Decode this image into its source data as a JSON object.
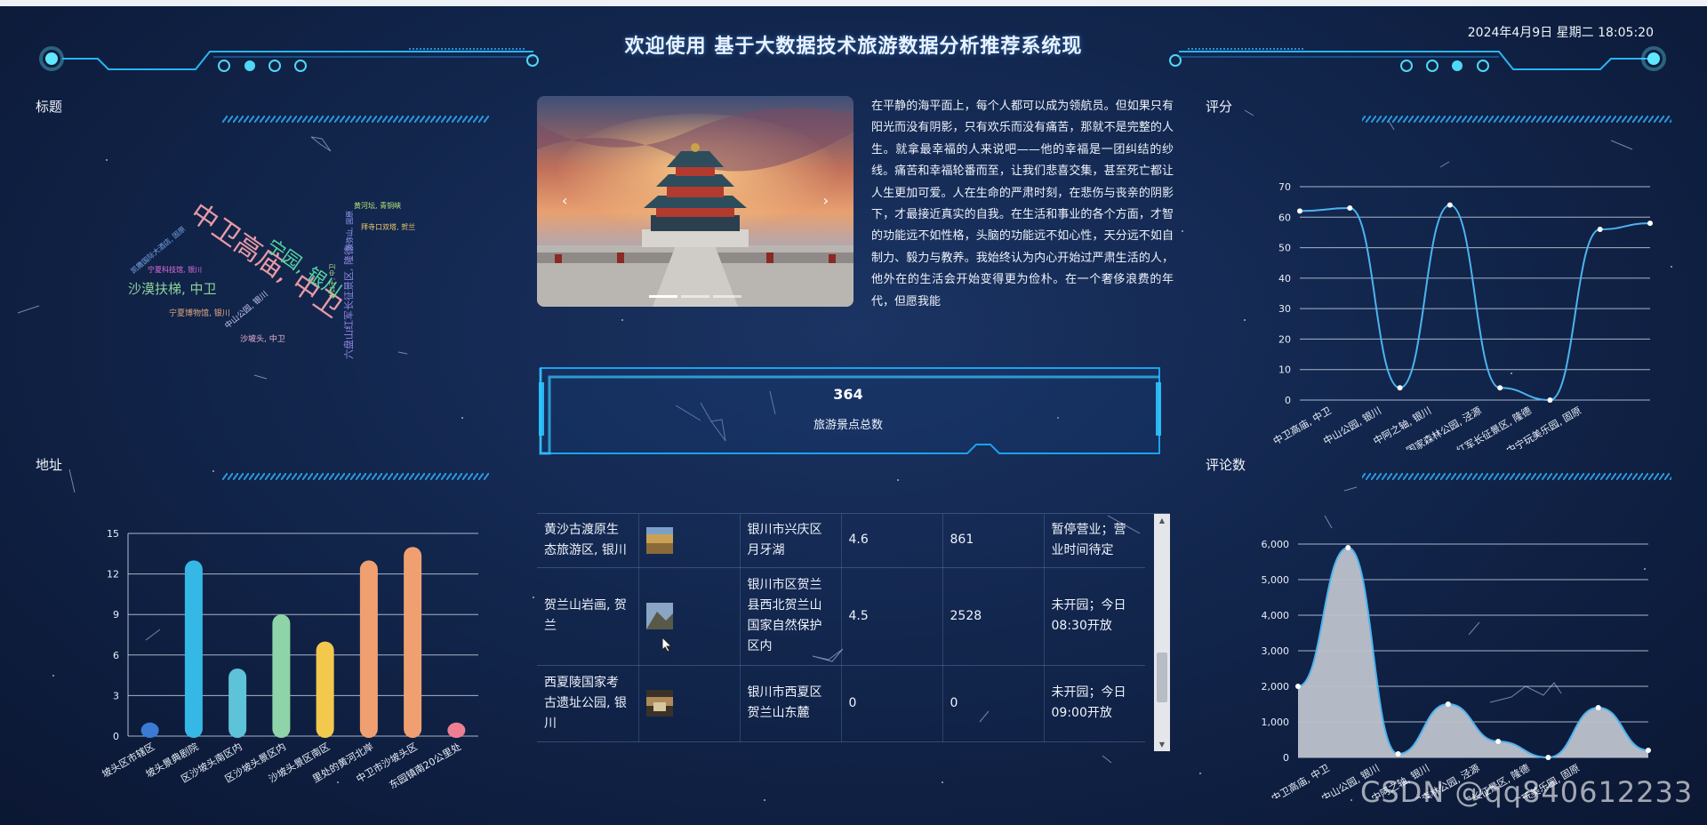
{
  "header": {
    "title": "欢迎使用 基于大数据技术旅游数据分析推荐系统现",
    "datetime": "2024年4月9日 星期二 18:05:20"
  },
  "panels": {
    "wordcloud_title": "标题",
    "address_title": "地址",
    "score_title": "评分",
    "comments_title": "评论数"
  },
  "wordcloud": [
    {
      "text": "中卫高庙, 中卫",
      "color": "#e89aa6"
    },
    {
      "text": "宁园, 银川",
      "color": "#55d6a0"
    },
    {
      "text": "沙漠扶梯, 中卫",
      "color": "#8fd19a"
    },
    {
      "text": "六盘山红军长征景区, 隆德",
      "color": "#8e86e0"
    },
    {
      "text": "宁夏博物馆, 银川",
      "color": "#e0a880"
    },
    {
      "text": "中山公园, 银川",
      "color": "#c9c9ee"
    },
    {
      "text": "沙坡头, 中卫",
      "color": "#f0b7d2"
    },
    {
      "text": "宁夏科技馆, 银川",
      "color": "#e06fe0"
    },
    {
      "text": "凯撒国际大酒店, 固原",
      "color": "#79a8e8"
    },
    {
      "text": "黄河坛, 青铜峡",
      "color": "#b8e47a"
    },
    {
      "text": "拜寺口双塔, 贺兰",
      "color": "#f0c86a"
    },
    {
      "text": "寺口子, 中卫",
      "color": "#b8e47a"
    },
    {
      "text": "须弥山, 固原",
      "color": "#9aa7ff"
    }
  ],
  "carousel": {
    "prev_icon": "chevron-left-icon",
    "next_icon": "chevron-right-icon",
    "slide_count": 3,
    "active_index": 0
  },
  "intro": {
    "text": "在平静的海平面上，每个人都可以成为领航员。但如果只有阳光而没有阴影，只有欢乐而没有痛苦，那就不是完整的人生。就拿最幸福的人来说吧——他的幸福是一团纠结的纱线。痛苦和幸福轮番而至，让我们悲喜交集，甚至死亡都让人生更加可爱。人在生命的严肃时刻，在悲伤与丧亲的阴影下，才最接近真实的自我。在生活和事业的各个方面，才智的功能远不如性格，头脑的功能远不如心性，天分远不如自制力、毅力与教养。我始终认为内心开始过严肃生活的人，他外在的生活会开始变得更为俭朴。在一个奢侈浪费的年代，但愿我能"
  },
  "stat": {
    "value": "364",
    "label": "旅游景点总数"
  },
  "table": {
    "rows": [
      {
        "name": "黄沙古渡原生态旅游区, 银川",
        "thumb_color": "#c9a055",
        "address": "银川市兴庆区月牙湖",
        "score": "4.6",
        "comments": "861",
        "status": "暂停营业；营业时间待定"
      },
      {
        "name": "贺兰山岩画, 贺兰",
        "thumb_color": "#7f8aa0",
        "address": "银川市区贺兰县西北贺兰山国家自然保护区内",
        "score": "4.5",
        "comments": "2528",
        "status": "未开园；今日08:30开放"
      },
      {
        "name": "西夏陵国家考古遗址公园, 银川",
        "thumb_color": "#6b5a44",
        "address": "银川市西夏区贺兰山东麓",
        "score": "0",
        "comments": "0",
        "status": "未开园；今日09:00开放"
      }
    ]
  },
  "watermark": "CSDN @qq840612233",
  "colors": {
    "accent": "#19a7ff",
    "line": "#4db3ef",
    "area": "#bdc2cc"
  },
  "chart_data": [
    {
      "id": "address",
      "type": "bar",
      "categories": [
        "中卫市沙坡头区市辖区",
        "沙坡头区沙坡头景典剧院",
        "沙坡头区沙坡头南区内",
        "沙坡头区沙坡头景区内",
        "沙坡头区沙坡头景区南区",
        "沙坡头区10公里处的黄河北岸",
        "中卫市沙坡头区",
        "沙坡头区东园镇南20公里处"
      ],
      "x_tick_labels": [
        "坡头区市辖区",
        "坡头景典剧院",
        "区沙坡头南区内",
        "区沙坡头景区内",
        "沙坡头景区南区",
        "里处的黄河北岸",
        "中卫市沙坡头区",
        "东园镇南20公里处"
      ],
      "values": [
        1,
        13,
        5,
        9,
        7,
        13,
        14,
        1
      ],
      "colors": [
        "#3a7bd5",
        "#35b8e6",
        "#5ec2d8",
        "#8fd4a8",
        "#f2c94c",
        "#f0a070",
        "#f0a070",
        "#ee7f93"
      ],
      "ylim": [
        0,
        15
      ],
      "yticks": [
        0,
        3,
        6,
        9,
        12,
        15
      ]
    },
    {
      "id": "score",
      "type": "line",
      "categories": [
        "中卫高庙, 中卫",
        "中山公园, 银川",
        "中阿之轴, 银川",
        "国家森林公园, 泾源",
        "六盘山红军长征景区, 隆德",
        "中宁玩美乐园, 固原"
      ],
      "x_tick_labels": [
        "中卫高庙, 中卫",
        "中山公园, 银川",
        "中阿之轴, 银川",
        "国家森林公园, 泾源",
        "红军长征景区, 隆德",
        "中宁玩美乐园, 固原"
      ],
      "x_tick_positions": [
        0.5,
        1.5,
        2.5,
        3.5,
        4.5,
        5.5
      ],
      "x": [
        0,
        1,
        2,
        3,
        4,
        5,
        6,
        7
      ],
      "values": [
        62,
        63,
        4,
        64,
        4,
        0,
        56,
        58
      ],
      "ylim": [
        0,
        70
      ],
      "yticks": [
        0,
        10,
        20,
        30,
        40,
        50,
        60,
        70
      ]
    },
    {
      "id": "comments",
      "type": "area",
      "categories": [
        "中卫高庙, 中卫",
        "中山公园, 银川",
        "中阿之轴, 银川",
        "国家森林公园, 泾源",
        "六盘山红军长征景区, 隆德",
        "中宁玩美乐园, 固原"
      ],
      "x_tick_labels": [
        "中卫高庙, 中卫",
        "中山公园, 银川",
        "中阿之轴, 银川",
        "国家森林公园, 泾源",
        "红军长征景区, 隆德",
        "中宁玩美乐园, 固原"
      ],
      "x_tick_positions": [
        0.5,
        1.5,
        2.5,
        3.5,
        4.5,
        5.5
      ],
      "x": [
        0,
        1,
        2,
        3,
        4,
        5,
        6,
        7
      ],
      "values": [
        2000,
        5900,
        100,
        1500,
        450,
        0,
        1400,
        200
      ],
      "ylim": [
        0,
        6000
      ],
      "yticks": [
        0,
        1000,
        2000,
        3000,
        4000,
        5000,
        6000
      ],
      "ytick_labels": [
        "0",
        "1,000",
        "2,000",
        "3,000",
        "4,000",
        "5,000",
        "6,000"
      ]
    }
  ]
}
